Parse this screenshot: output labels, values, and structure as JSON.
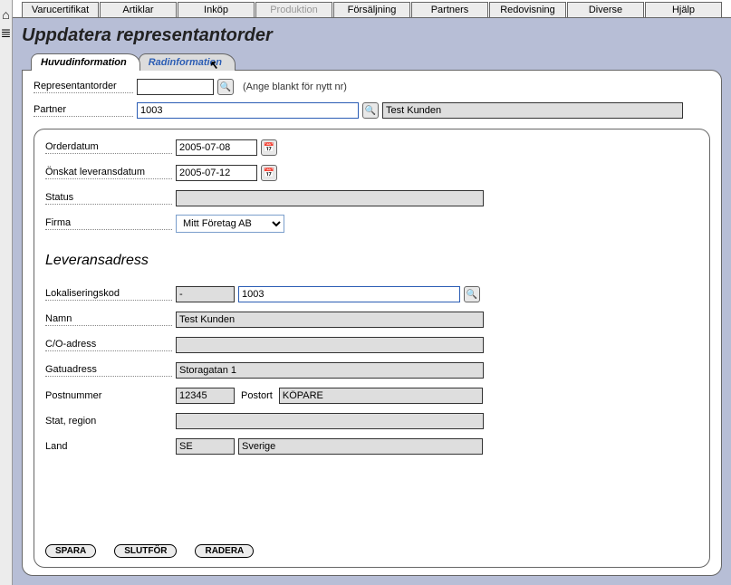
{
  "menu": {
    "items": [
      "Varucertifikat",
      "Artiklar",
      "Inköp",
      "Produktion",
      "Försäljning",
      "Partners",
      "Redovisning",
      "Diverse",
      "Hjälp"
    ],
    "disabled_index": 3
  },
  "page_title": "Uppdatera representantorder",
  "tabs": {
    "t0": "Huvudinformation",
    "t1": "Radinformation"
  },
  "head": {
    "order_label": "Representantorder",
    "order_value": "",
    "order_hint": "(Ange blankt för nytt nr)",
    "partner_label": "Partner",
    "partner_value": "1003",
    "partner_name": "Test Kunden"
  },
  "detail": {
    "orderdate_label": "Orderdatum",
    "orderdate_value": "2005-07-08",
    "delivdate_label": "Önskat leveransdatum",
    "delivdate_value": "2005-07-12",
    "status_label": "Status",
    "status_value": "",
    "firm_label": "Firma",
    "firm_value": "Mitt Företag AB"
  },
  "address": {
    "section_title": "Leveransadress",
    "loccode_label": "Lokaliseringskod",
    "loccode_prefix": "-",
    "loccode_value": "1003",
    "name_label": "Namn",
    "name_value": "Test Kunden",
    "co_label": "C/O-adress",
    "co_value": "",
    "street_label": "Gatuadress",
    "street_value": "Storagatan 1",
    "postcode_label": "Postnummer",
    "postcode_value": "12345",
    "postort_label": "Postort",
    "postort_value": "KÖPARE",
    "region_label": "Stat, region",
    "region_value": "",
    "country_label": "Land",
    "country_code": "SE",
    "country_name": "Sverige"
  },
  "actions": {
    "save": "SPARA",
    "finish": "SLUTFÖR",
    "delete": "RADERA"
  },
  "icons": {
    "home": "⌂",
    "list": "≣",
    "search": "🔍",
    "calendar": "📅"
  }
}
